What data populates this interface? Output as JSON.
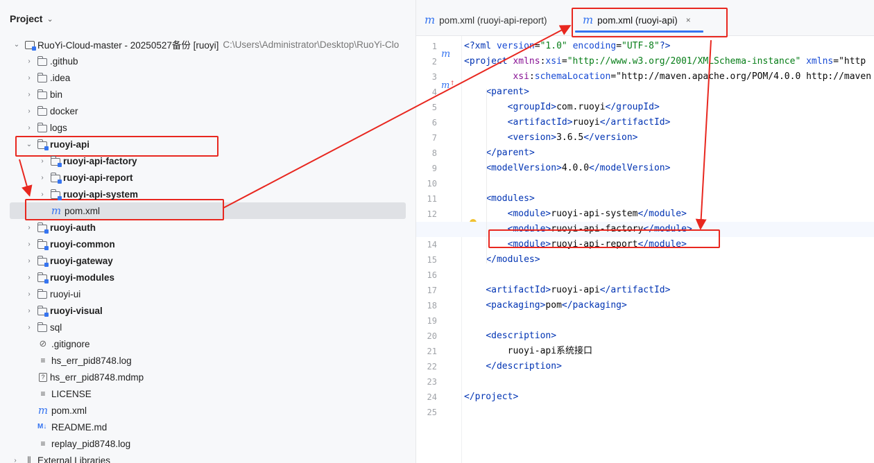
{
  "project_panel": {
    "title": "Project",
    "root": {
      "label": "RuoYi-Cloud-master - 20250527备份 [ruoyi]",
      "path": "C:\\Users\\Administrator\\Desktop\\RuoYi-Clo"
    },
    "items": [
      {
        "label": ".github",
        "type": "folder"
      },
      {
        "label": ".idea",
        "type": "folder"
      },
      {
        "label": "bin",
        "type": "folder"
      },
      {
        "label": "docker",
        "type": "folder"
      },
      {
        "label": "logs",
        "type": "folder"
      },
      {
        "label": "ruoyi-api",
        "type": "module",
        "expanded": true
      },
      {
        "label": "ruoyi-api-factory",
        "type": "module"
      },
      {
        "label": "ruoyi-api-report",
        "type": "module"
      },
      {
        "label": "ruoyi-api-system",
        "type": "module"
      },
      {
        "label": "pom.xml",
        "type": "maven",
        "selected": true
      },
      {
        "label": "ruoyi-auth",
        "type": "module"
      },
      {
        "label": "ruoyi-common",
        "type": "module"
      },
      {
        "label": "ruoyi-gateway",
        "type": "module"
      },
      {
        "label": "ruoyi-modules",
        "type": "module"
      },
      {
        "label": "ruoyi-ui",
        "type": "folder"
      },
      {
        "label": "ruoyi-visual",
        "type": "module"
      },
      {
        "label": "sql",
        "type": "folder"
      },
      {
        "label": ".gitignore",
        "type": "ignore"
      },
      {
        "label": "hs_err_pid8748.log",
        "type": "text"
      },
      {
        "label": "hs_err_pid8748.mdmp",
        "type": "unknown"
      },
      {
        "label": "LICENSE",
        "type": "text"
      },
      {
        "label": "pom.xml",
        "type": "maven"
      },
      {
        "label": "README.md",
        "type": "markdown"
      },
      {
        "label": "replay_pid8748.log",
        "type": "text"
      },
      {
        "label": "External Libraries",
        "type": "library"
      }
    ]
  },
  "editor": {
    "tabs": [
      {
        "label": "pom.xml (ruoyi-api-report)",
        "active": false
      },
      {
        "label": "pom.xml (ruoyi-api)",
        "active": true,
        "close": "×"
      }
    ],
    "current_line": 13,
    "lines": [
      "<?xml version=\"1.0\" encoding=\"UTF-8\"?>",
      "<project xmlns:xsi=\"http://www.w3.org/2001/XMLSchema-instance\" xmlns=\"http",
      "         xsi:schemaLocation=\"http://maven.apache.org/POM/4.0.0 http://maven",
      "    <parent>",
      "        <groupId>com.ruoyi</groupId>",
      "        <artifactId>ruoyi</artifactId>",
      "        <version>3.6.5</version>",
      "    </parent>",
      "    <modelVersion>4.0.0</modelVersion>",
      "",
      "    <modules>",
      "        <module>ruoyi-api-system</module>",
      "        <module>ruoyi-api-factory</module>",
      "        <module>ruoyi-api-report</module>",
      "    </modules>",
      "",
      "    <artifactId>ruoyi-api</artifactId>",
      "    <packaging>pom</packaging>",
      "",
      "    <description>",
      "        ruoyi-api系统接口",
      "    </description>",
      "",
      "</project>",
      ""
    ]
  },
  "colors": {
    "accent": "#3574f0",
    "annotation_red": "#e8271f",
    "xml_tag": "#0033b3",
    "xml_attr_value": "#067d17"
  }
}
